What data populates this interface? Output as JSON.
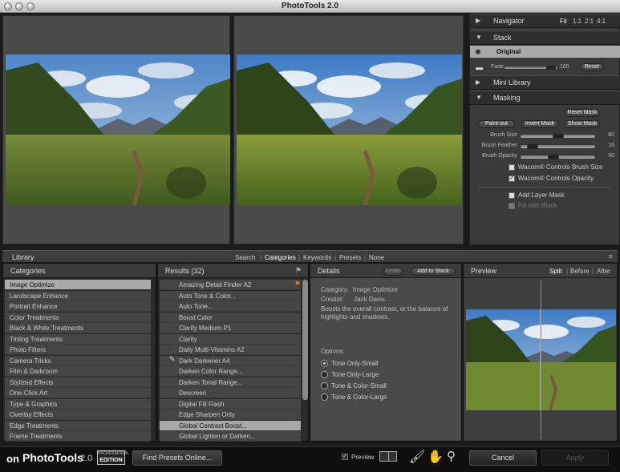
{
  "window": {
    "title": "PhotoTools 2.0"
  },
  "navigator": {
    "label": "Navigator",
    "zoom_options": [
      "Fit",
      "1:1",
      "2:1",
      "4:1"
    ]
  },
  "stack": {
    "label": "Stack",
    "item": "Original",
    "fade_label": "Fade",
    "fade_value": "100",
    "reset_label": "Reset"
  },
  "mini_library": {
    "label": "Mini Library"
  },
  "masking": {
    "label": "Masking",
    "reset_mask": "Reset Mask",
    "paint_out": "Paint-out",
    "invert_mask": "Invert Mask",
    "show_mask": "Show Mask",
    "sliders": [
      {
        "label": "Brush Size",
        "value": "80"
      },
      {
        "label": "Brush Feather",
        "value": "16"
      },
      {
        "label": "Brush Opacity",
        "value": "50"
      }
    ],
    "wacom_size": "Wacom® Controls Brush Size",
    "wacom_opacity": "Wacom® Controls Opacity",
    "add_layer_mask": "Add Layer Mask",
    "fill_black": "Fill with Black"
  },
  "library": {
    "label": "Library",
    "filters": [
      "Search",
      "Categories",
      "Keywords",
      "Presets",
      "None"
    ]
  },
  "categories": {
    "header": "Categories",
    "items": [
      "Image Optimize",
      "Landscape Enhance",
      "Portrait Enhance",
      "Color Treatments",
      "Black & White Treatments",
      "Tinting Treatments",
      "Photo Filters",
      "Camera Tricks",
      "Film & Darkroom",
      "Stylized Effects",
      "One-Click Art",
      "Type & Graphics",
      "Overlay Effects",
      "Edge Treatments",
      "Frame Treatments"
    ]
  },
  "results": {
    "header": "Results (32)",
    "items": [
      "Amazing Detail Finder A2",
      "Auto Tone & Color...",
      "Auto Tone...",
      "Boost Color",
      "Clarify Medium P1",
      "Clarity",
      "Daily Multi-Vitamins A2",
      "Dark Darkener A4",
      "Darken Color Range...",
      "Darken Tonal Range...",
      "Descreen",
      "Digital Fill Flash",
      "Edge Sharpen Only",
      "Global Contrast Boost...",
      "Global Lighten or Darken..."
    ]
  },
  "details": {
    "header": "Details",
    "undo": "Undo",
    "add_to_stack": "Add to Stack",
    "category_label": "Category:",
    "category_value": "Image Optimize",
    "creator_label": "Creator:",
    "creator_value": "Jack Davis",
    "description": "Boosts the overall contrast, or the balance of highlights and shadows.",
    "options_label": "Options:",
    "options": [
      "Tone Only-Small",
      "Tone Only-Large",
      "Tone & Color-Small",
      "Tone & Color-Large"
    ]
  },
  "preview": {
    "header": "Preview",
    "modes": [
      "Split",
      "Before",
      "After"
    ]
  },
  "bottom": {
    "logo_on": "on",
    "logo_text": "PhotoTools",
    "logo_version": "2.0",
    "edition_top": "PROFESSIONAL",
    "edition_bottom": "EDITION",
    "find_presets": "Find Presets Online...",
    "preview_label": "Preview",
    "cancel": "Cancel",
    "apply": "Apply"
  },
  "colors": {
    "selected_row": "#a9a9a9",
    "panel_bg": "#2a2a2a",
    "list_bg": "#454545"
  }
}
